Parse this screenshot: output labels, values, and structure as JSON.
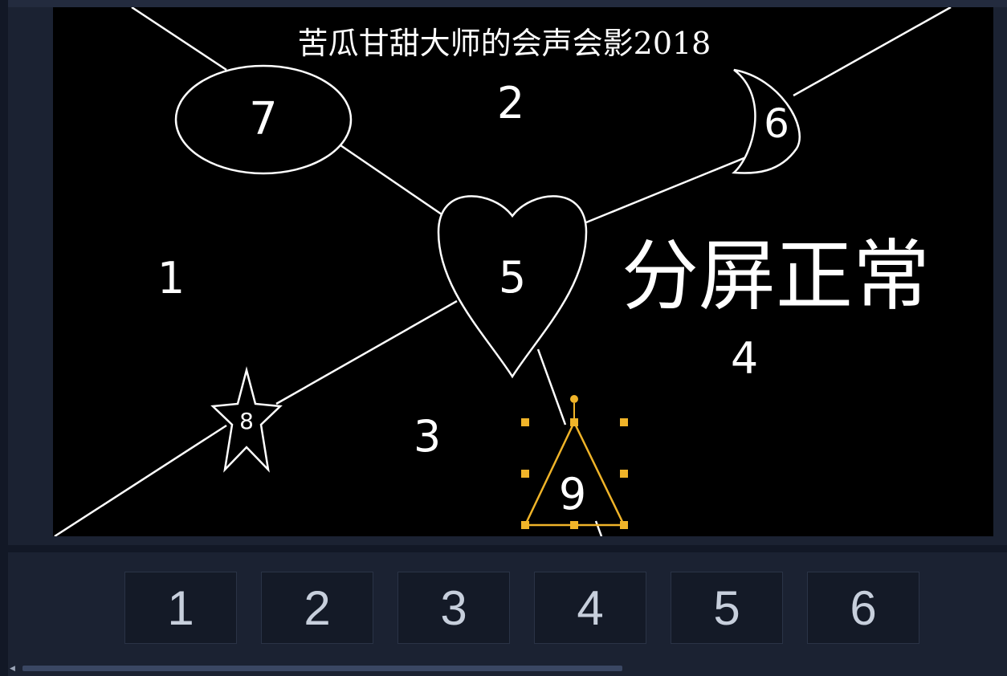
{
  "preview": {
    "overlay_title": "苦瓜甘甜大师的会声会影2018",
    "big_caption": "分屏正常",
    "region_labels": [
      "1",
      "2",
      "3",
      "4"
    ],
    "shape_labels": {
      "heart": "5",
      "moon": "6",
      "ellipse": "7",
      "star": "8",
      "triangle": "9"
    },
    "selection_color": "#f0b429"
  },
  "tracks": {
    "thumbnails": [
      "1",
      "2",
      "3",
      "4",
      "5",
      "6"
    ]
  },
  "colors": {
    "background": "#1b2232",
    "preview_bg": "#000000",
    "line": "#ffffff",
    "thumb_text": "#c7cfdc"
  }
}
